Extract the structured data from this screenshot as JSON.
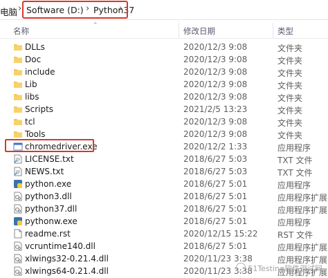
{
  "address_bar": {
    "left_crumb": "电脑",
    "crumb_drive": "Software (D:)",
    "crumb_folder": "Python37",
    "highlight_color": "#d9362b"
  },
  "columns": {
    "name": "名称",
    "date": "修改日期",
    "type": "类型"
  },
  "files": [
    {
      "name": "DLLs",
      "date": "2020/12/3 9:08",
      "type": "文件夹",
      "icon": "folder-icon"
    },
    {
      "name": "Doc",
      "date": "2020/12/3 9:08",
      "type": "文件夹",
      "icon": "folder-icon"
    },
    {
      "name": "include",
      "date": "2020/12/3 9:08",
      "type": "文件夹",
      "icon": "folder-icon"
    },
    {
      "name": "Lib",
      "date": "2020/12/3 9:08",
      "type": "文件夹",
      "icon": "folder-icon"
    },
    {
      "name": "libs",
      "date": "2020/12/3 9:08",
      "type": "文件夹",
      "icon": "folder-icon"
    },
    {
      "name": "Scripts",
      "date": "2021/2/5 13:23",
      "type": "文件夹",
      "icon": "folder-icon"
    },
    {
      "name": "tcl",
      "date": "2020/12/3 9:08",
      "type": "文件夹",
      "icon": "folder-icon"
    },
    {
      "name": "Tools",
      "date": "2020/12/3 9:08",
      "type": "文件夹",
      "icon": "folder-icon"
    },
    {
      "name": "chromedriver.exe",
      "date": "2020/12/2 1:33",
      "type": "应用程序",
      "icon": "exe-window-icon"
    },
    {
      "name": "LICENSE.txt",
      "date": "2018/6/27 5:03",
      "type": "TXT 文件",
      "icon": "text-file-icon"
    },
    {
      "name": "NEWS.txt",
      "date": "2018/6/27 5:03",
      "type": "TXT 文件",
      "icon": "text-file-icon"
    },
    {
      "name": "python.exe",
      "date": "2018/6/27 5:01",
      "type": "应用程序",
      "icon": "python-icon"
    },
    {
      "name": "python3.dll",
      "date": "2018/6/27 5:01",
      "type": "应用程序扩展",
      "icon": "dll-icon"
    },
    {
      "name": "python37.dll",
      "date": "2018/6/27 5:01",
      "type": "应用程序扩展",
      "icon": "dll-icon"
    },
    {
      "name": "pythonw.exe",
      "date": "2018/6/27 5:01",
      "type": "应用程序",
      "icon": "python-icon"
    },
    {
      "name": "readme.rst",
      "date": "2020/12/15 15:22",
      "type": "RST 文件",
      "icon": "generic-file-icon"
    },
    {
      "name": "vcruntime140.dll",
      "date": "2018/6/27 5:01",
      "type": "应用程序扩展",
      "icon": "dll-icon"
    },
    {
      "name": "xlwings32-0.21.4.dll",
      "date": "2020/11/23 3:38",
      "type": "应用程序扩展",
      "icon": "dll-icon"
    },
    {
      "name": "xlwings64-0.21.4.dll",
      "date": "2020/11/23 3:38",
      "type": "应用程序扩展",
      "icon": "dll-icon"
    }
  ],
  "watermark": "51Testing软件测试网"
}
